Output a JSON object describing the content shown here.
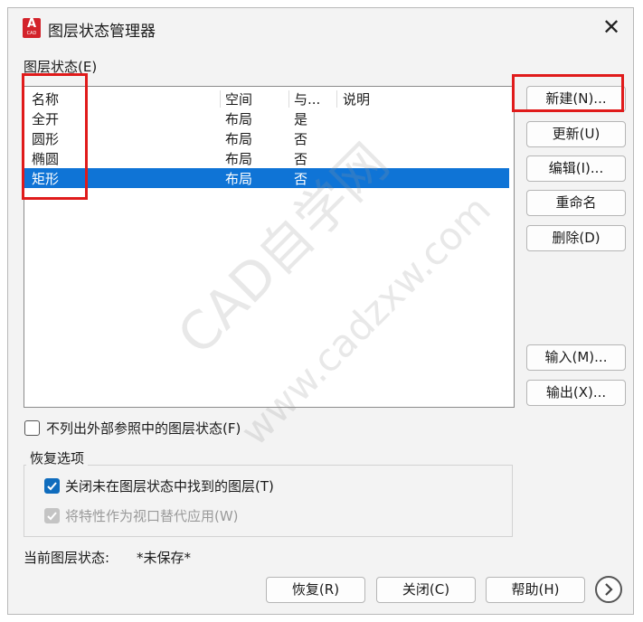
{
  "window": {
    "title": "图层状态管理器",
    "icon_label": "A",
    "icon_sub": "CAD"
  },
  "states_label": "图层状态(E)",
  "list": {
    "headers": [
      "名称",
      "空间",
      "与...",
      "说明"
    ],
    "rows": [
      {
        "name": "全开",
        "space": "布局",
        "same": "是",
        "desc": ""
      },
      {
        "name": "圆形",
        "space": "布局",
        "same": "否",
        "desc": ""
      },
      {
        "name": "椭圆",
        "space": "布局",
        "same": "否",
        "desc": ""
      },
      {
        "name": "矩形",
        "space": "布局",
        "same": "否",
        "desc": "",
        "selected": true
      }
    ]
  },
  "side_buttons": {
    "new": "新建(N)...",
    "update": "更新(U)",
    "edit": "编辑(I)...",
    "rename": "重命名",
    "delete": "删除(D)",
    "import": "输入(M)...",
    "export": "输出(X)..."
  },
  "options": {
    "exclude_xref": {
      "label": "不列出外部参照中的图层状态(F)",
      "checked": false
    },
    "restore_group_title": "恢复选项",
    "turn_off_layers": {
      "label": "关闭未在图层状态中找到的图层(T)",
      "checked": true
    },
    "apply_viewport": {
      "label": "将特性作为视口替代应用(W)",
      "checked": true,
      "disabled": true
    }
  },
  "current_state": {
    "label": "当前图层状态:",
    "value": "*未保存*"
  },
  "bottom_buttons": {
    "restore": "恢复(R)",
    "close": "关闭(C)",
    "help": "帮助(H)"
  },
  "watermark": {
    "line1": "CAD自学网",
    "line2": "www.cadzxw.com"
  },
  "colors": {
    "selection": "#0f74d6",
    "highlight": "#e01b1b",
    "checkbox_checked": "#0f6cbd"
  },
  "icons": {
    "close": "close-icon",
    "expand": "chevron-right-icon",
    "check": "check-icon"
  }
}
